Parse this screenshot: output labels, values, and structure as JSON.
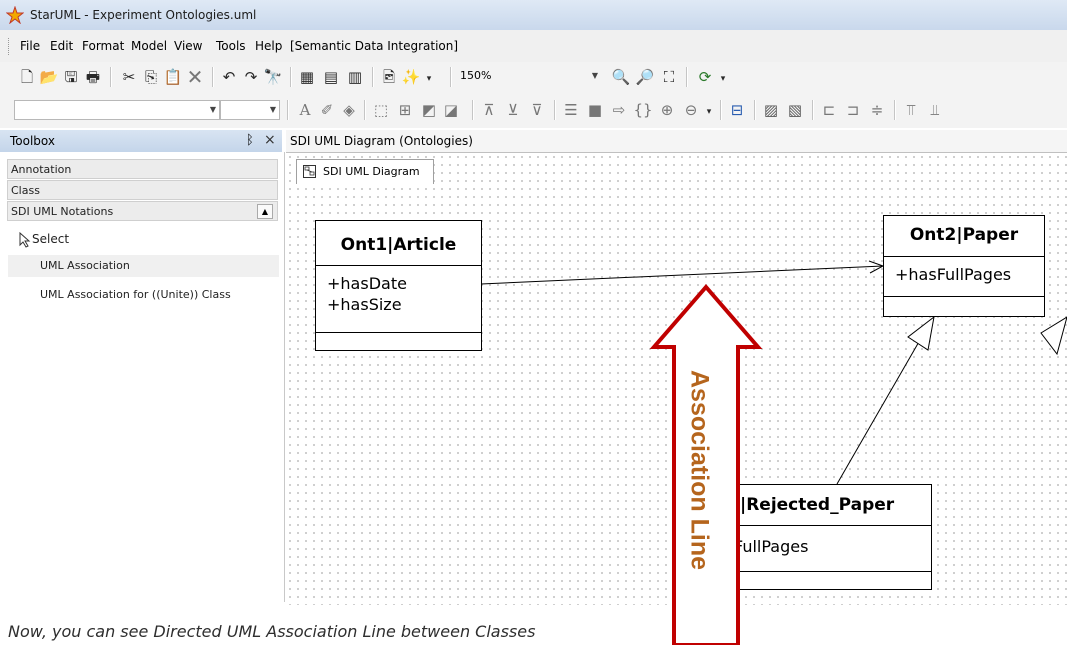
{
  "window": {
    "title": "StarUML - Experiment Ontologies.uml",
    "icon": "staruml-star-icon"
  },
  "menu": {
    "items": [
      "File",
      "Edit",
      "Format",
      "Model",
      "View",
      "Tools",
      "Help",
      "[Semantic Data Integration]"
    ]
  },
  "toolbar": {
    "zoom": "150%",
    "font_name": "",
    "font_size": ""
  },
  "toolbox": {
    "title": "Toolbox",
    "pin_glyph": "⭕",
    "close_glyph": "×",
    "categories": [
      "Annotation",
      "Class",
      "SDI UML Notations"
    ],
    "items": [
      "Select",
      "UML Association",
      "UML Association for ((Unite)) Class"
    ]
  },
  "document": {
    "tab_title": "SDI UML Diagram (Ontologies)",
    "diagram_tab": "SDI UML Diagram"
  },
  "diagram": {
    "classes": [
      {
        "name": "Ont1|Article",
        "attributes": [
          "+hasDate",
          "+hasSize"
        ]
      },
      {
        "name": "Ont2|Paper",
        "attributes": [
          "+hasFullPages"
        ]
      },
      {
        "name": "|Rejected_Paper",
        "attributes": [
          "FullPages"
        ]
      }
    ],
    "annotation_label": "Association Line",
    "annotation_color": "#b5651d",
    "arrow_outline_color": "#c00000"
  },
  "caption": "Now, you can see Directed UML Association Line between Classes"
}
